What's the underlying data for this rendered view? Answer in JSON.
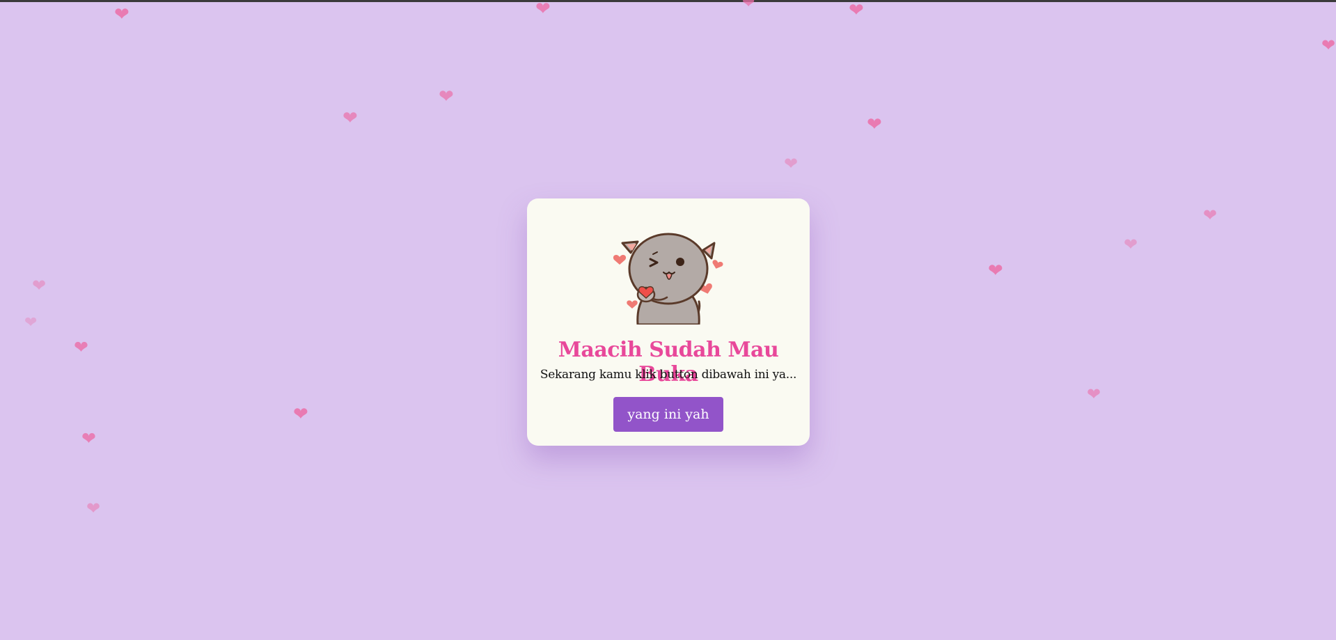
{
  "colors": {
    "background": "#dbc4ef",
    "card": "#fafaf2",
    "title": "#e8489a",
    "button": "#9254c9",
    "heart": "#ec6fa8"
  },
  "card": {
    "image_icon": "cat-with-hearts-icon",
    "title": "Maacih Sudah Mau Buka",
    "subtitle": "Sekarang kamu klik button dibawah ini ya...",
    "button_label": "yang ini yah"
  },
  "decorations": {
    "icon": "heart-icon"
  }
}
